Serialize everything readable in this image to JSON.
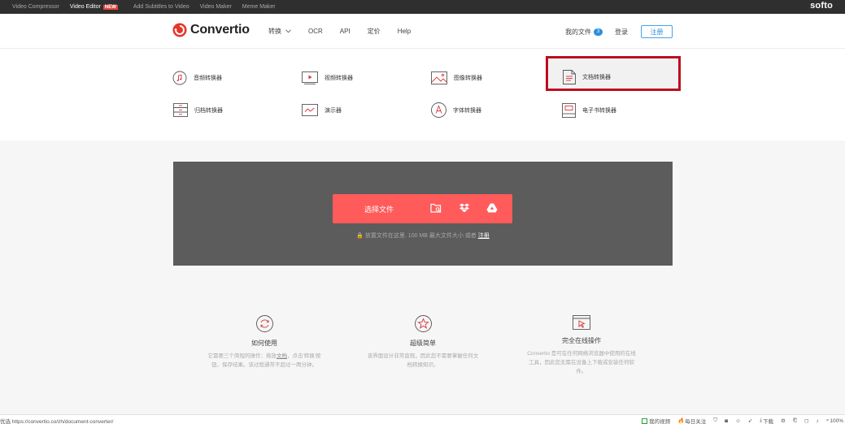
{
  "topbar": {
    "links": [
      "Video Compressor",
      "Video Editor",
      "Add Subtitles to Video",
      "Video Maker",
      "Meme Maker"
    ],
    "new_badge": "NEW",
    "brand": "softo"
  },
  "header": {
    "logo_text": "Convertio",
    "nav": [
      "转换",
      "OCR",
      "API",
      "定价",
      "Help"
    ],
    "my_files": "我的文件",
    "files_count": "3",
    "login": "登录",
    "register": "注册"
  },
  "converters": [
    {
      "label": "音频转换器",
      "icon": "audio-icon"
    },
    {
      "label": "视频转换器",
      "icon": "video-icon"
    },
    {
      "label": "图像转换器",
      "icon": "image-icon"
    },
    {
      "label": "文档转换器",
      "icon": "document-icon"
    },
    {
      "label": "归档转换器",
      "icon": "archive-icon"
    },
    {
      "label": "演示器",
      "icon": "presentation-icon"
    },
    {
      "label": "字体转换器",
      "icon": "font-icon"
    },
    {
      "label": "电子书转换器",
      "icon": "ebook-icon"
    }
  ],
  "upload": {
    "choose_label": "选择文件",
    "hint_prefix": "放置文件在这里. 100 MB 最大文件大小 或者",
    "hint_link": "注册"
  },
  "features": [
    {
      "title": "如何使用",
      "desc_a": "它需要三个简短的操作：拖放",
      "desc_link": "文档",
      "desc_b": "，点击'转换'按钮，保存结果。该过程通常不超过一两分钟。",
      "icon": "refresh-icon"
    },
    {
      "title": "超级简单",
      "desc": "该界面设计非常直观，因此您不需要掌握任何文档转换知识。",
      "icon": "star-icon"
    },
    {
      "title": "完全在线操作",
      "desc": "Convertio 是可在任何网络浏览器中使用的在线工具，因此您无需在设备上下载或安装任何软件。",
      "icon": "browser-cursor-icon"
    }
  ],
  "status": {
    "url": "优选 https://convertio.co/zh/document-converter/",
    "items": [
      "我的视频",
      "每日关注",
      "下载",
      "100%"
    ]
  },
  "colors": {
    "accent": "#ff5b5b",
    "highlight": "#bd0d1f",
    "blue": "#2b8ede",
    "upload_bg": "#5c5c5c"
  }
}
